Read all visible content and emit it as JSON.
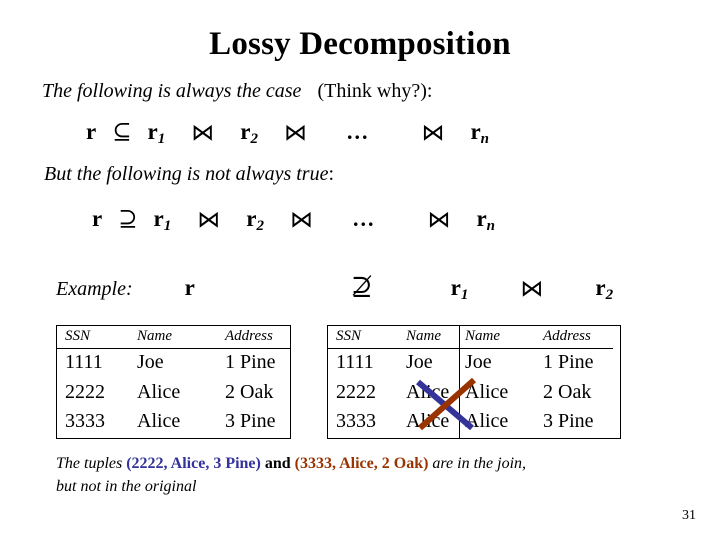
{
  "slide": {
    "title": "Lossy Decomposition",
    "page_number": "31"
  },
  "statements": {
    "line1_italic": "The following is always the case",
    "line1_upright": "(Think why?):",
    "line2": "But the following is not always true",
    "line2_colon": ":"
  },
  "formulas": {
    "always_true": {
      "lhs": "r",
      "operator": "⊆",
      "operator_name": "subset-or-equal",
      "terms": [
        "r",
        "r",
        "r"
      ],
      "subscripts": [
        "1",
        "2",
        "n"
      ],
      "join_symbol": "⋈",
      "ellipsis": "..."
    },
    "not_always_true": {
      "lhs": "r",
      "operator": "⊇",
      "operator_name": "superset-or-equal",
      "terms": [
        "r",
        "r",
        "r"
      ],
      "subscripts": [
        "1",
        "2",
        "n"
      ],
      "join_symbol": "⋈",
      "ellipsis": "..."
    },
    "example": {
      "label": "Example",
      "label_colon": ":",
      "lhs": "r",
      "operator": "⊉",
      "operator_name": "not-superset-or-equal",
      "term1": "r",
      "term1_sub": "1",
      "join_symbol": "⋈",
      "term2": "r",
      "term2_sub": "2"
    }
  },
  "tables": {
    "r": {
      "name": "r",
      "headers": [
        "SSN",
        "Name",
        "Address"
      ],
      "rows": [
        [
          "1111",
          "Joe",
          "1 Pine"
        ],
        [
          "2222",
          "Alice",
          "2 Oak"
        ],
        [
          "3333",
          "Alice",
          "3 Pine"
        ]
      ]
    },
    "r1": {
      "name": "r1",
      "headers": [
        "SSN",
        "Name"
      ],
      "rows": [
        [
          "1111",
          "Joe"
        ],
        [
          "2222",
          "Alice"
        ],
        [
          "3333",
          "Alice"
        ]
      ]
    },
    "r2": {
      "name": "r2",
      "headers": [
        "Name",
        "Address"
      ],
      "rows": [
        [
          "Joe",
          "1 Pine"
        ],
        [
          "Alice",
          "2 Oak"
        ],
        [
          "Alice",
          "3 Pine"
        ]
      ]
    }
  },
  "footnote": {
    "prefix": "The tuples",
    "tuple_blue": "(2222, Alice, 3 Pine)",
    "conjunction": "and",
    "tuple_brown": "(3333, Alice, 2 Oak)",
    "middle": "are",
    "suffix": "in the join,",
    "line2": "but not in the original"
  },
  "colors": {
    "tuple_blue": "#333399",
    "tuple_brown": "#993300",
    "cross_blue": "#333399",
    "cross_brown": "#993300",
    "text": "#000000",
    "background": "#ffffff",
    "border": "#000000"
  }
}
